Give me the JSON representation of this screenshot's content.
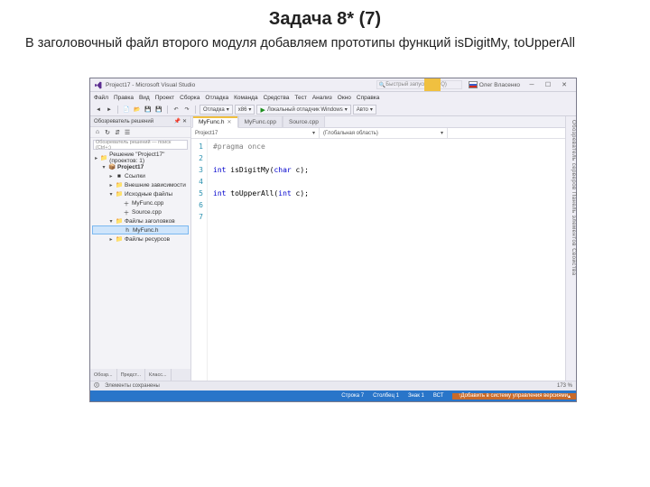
{
  "slide": {
    "title": "Задача 8* (7)",
    "subtitle": "В заголовочный файл второго модуля добавляем прототипы функций isDigitMy, toUpperAll"
  },
  "window": {
    "title": "Project17 - Microsoft Visual Studio",
    "quick_launch": "Быстрый запуск (Ctrl+Q)",
    "account": "Олег Власенко"
  },
  "menu": [
    "Файл",
    "Правка",
    "Вид",
    "Проект",
    "Сборка",
    "Отладка",
    "Команда",
    "Средства",
    "Тест",
    "Анализ",
    "Окно",
    "Справка"
  ],
  "toolbar": {
    "debug": "Отладка",
    "platform": "x86",
    "run_label": "Локальный отладчик Windows",
    "thread": "Авто"
  },
  "sidebar": {
    "title": "Обозреватель решений",
    "search": "Обозреватель решений — поиск (Ctrl+;)",
    "solution": "Решение \"Project17\" (проектов: 1)",
    "project": "Project17",
    "nodes": {
      "references": "Ссылки",
      "external": "Внешние зависимости",
      "source": "Исходные файлы",
      "file1": "MyFunc.cpp",
      "file2": "Source.cpp",
      "headers": "Файлы заголовков",
      "hfile": "MyFunc.h",
      "resources": "Файлы ресурсов"
    },
    "tabs": [
      "Обозр...",
      "Предст...",
      "Класс..."
    ]
  },
  "tabs": [
    {
      "label": "MyFunc.h",
      "active": true
    },
    {
      "label": "MyFunc.cpp",
      "active": false
    },
    {
      "label": "Source.cpp",
      "active": false
    }
  ],
  "nav": {
    "project": "Project17",
    "scope": "(Глобальная область)"
  },
  "code": {
    "line1": "#pragma once",
    "line3_kw1": "int",
    "line3_fn": " isDigitMy(",
    "line3_kw2": "char",
    "line3_end": " c);",
    "line5_kw1": "int",
    "line5_fn": " toUpperAll(",
    "line5_kw2": "int",
    "line5_end": " c);",
    "line_numbers": [
      "1",
      "2",
      "3",
      "4",
      "5",
      "6",
      "7"
    ]
  },
  "errlist": {
    "label": "Элементы сохранены",
    "zoom": "173 %"
  },
  "status": {
    "line": "Строка 7",
    "col": "Столбец 1",
    "char": "Знак 1",
    "ins": "ВСТ",
    "vcs": "Добавить в систему управления версиями"
  },
  "vbar_text": "Обозреватель серверов   Панель элементов   Свойства"
}
